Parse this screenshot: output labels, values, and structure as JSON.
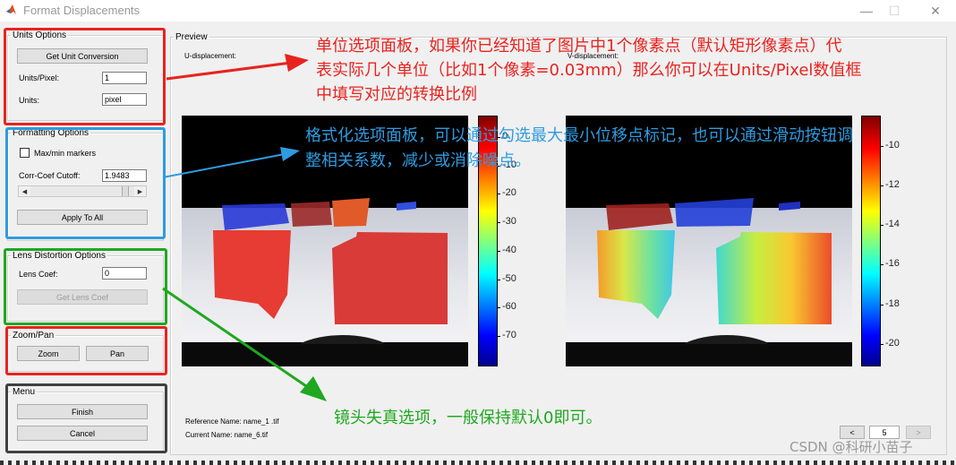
{
  "window": {
    "title": "Format Displacements",
    "controls": {
      "minimize": "—",
      "maximize": "☐",
      "close": "✕"
    }
  },
  "units_options": {
    "legend": "Units Options",
    "get_unit_conversion": "Get Unit Conversion",
    "units_per_pixel_label": "Units/Pixel:",
    "units_per_pixel_value": "1",
    "units_label": "Units:",
    "units_value": "pixel"
  },
  "formatting_options": {
    "legend": "Formatting Options",
    "maxmin_markers_label": "Max/min markers",
    "maxmin_markers_checked": false,
    "corr_coef_label": "Corr-Coef Cutoff:",
    "corr_coef_value": "1.9483",
    "slider_position_fraction": 0.93,
    "apply_to_all": "Apply To All"
  },
  "lens_distortion": {
    "legend": "Lens Distortion Options",
    "lens_coef_label": "Lens Coef:",
    "lens_coef_value": "0",
    "get_lens_coef": "Get Lens Coef"
  },
  "zoom_pan": {
    "legend": "Zoom/Pan",
    "zoom": "Zoom",
    "pan": "Pan"
  },
  "menu": {
    "legend": "Menu",
    "finish": "Finish",
    "cancel": "Cancel"
  },
  "preview": {
    "legend": "Preview",
    "u_label": "U-displacement:",
    "v_label": "V-displacement:",
    "u_colorbar_ticks": [
      "0",
      "-10",
      "-20",
      "-30",
      "-40",
      "-50",
      "-60",
      "-70"
    ],
    "v_colorbar_ticks": [
      "-10",
      "-12",
      "-14",
      "-16",
      "-18",
      "-20"
    ],
    "reference_name": "Reference Name: name_1 .tif",
    "current_name": "Current Name: name_6.tif",
    "prev_button": "<",
    "next_button": ">",
    "image_index": "5"
  },
  "annotations": {
    "red_note_lines": [
      "单位选项面板，如果你已经知道了图片中1个像素点（默认矩形像素点）代",
      "表实际几个单位（比如1个像素=0.03mm）那么你可以在Units/Pixel数值框",
      "中填写对应的转换比例"
    ],
    "blue_note_lines": [
      "格式化选项面板，可以通过勾选最大最小位移点标记，也可以通过滑动按钮调",
      "整相关系数，减少或消除噪点。"
    ],
    "green_note": "镜头失真选项，一般保持默认0即可。",
    "watermark": "CSDN @科研小苗子",
    "colors": {
      "red": "#e8231f",
      "blue": "#2f9be0",
      "green": "#1fa81f",
      "dark": "#404040"
    }
  }
}
